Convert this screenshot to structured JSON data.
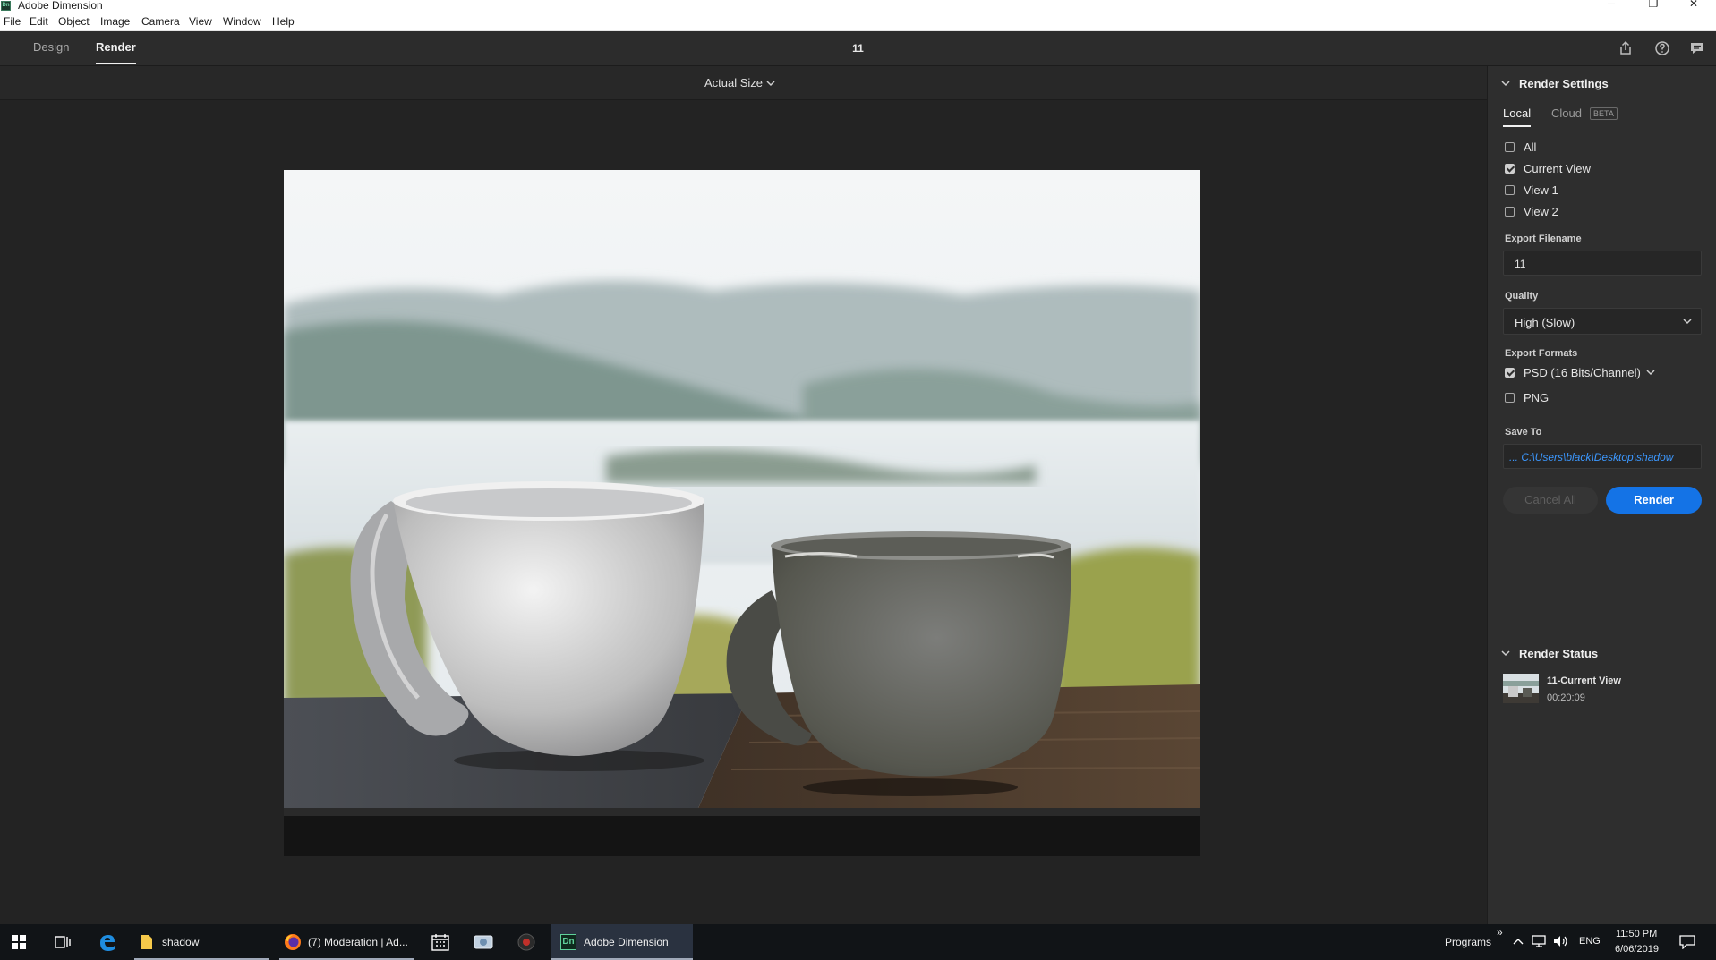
{
  "window": {
    "title": "Adobe Dimension",
    "app_icon_text": "Dn",
    "controls": {
      "minimize": "─",
      "restore": "❐",
      "close": "✕"
    }
  },
  "menu": [
    "File",
    "Edit",
    "Object",
    "Image",
    "Camera",
    "View",
    "Window",
    "Help"
  ],
  "mode_tabs": [
    {
      "label": "Design",
      "active": false
    },
    {
      "label": "Render",
      "active": true
    }
  ],
  "document_name": "11",
  "view": {
    "zoom_label": "Actual Size"
  },
  "render_settings": {
    "title": "Render Settings",
    "tabs": [
      {
        "label": "Local",
        "active": true
      },
      {
        "label": "Cloud",
        "active": false
      }
    ],
    "beta_badge": "BETA",
    "views": [
      {
        "label": "All",
        "checked": false
      },
      {
        "label": "Current View",
        "checked": true
      },
      {
        "label": "View 1",
        "checked": false
      },
      {
        "label": "View 2",
        "checked": false
      }
    ],
    "export_filename_label": "Export Filename",
    "export_filename_value": "11",
    "quality_label": "Quality",
    "quality_value": "High (Slow)",
    "export_formats_label": "Export Formats",
    "formats": [
      {
        "label": "PSD (16 Bits/Channel)",
        "checked": true
      },
      {
        "label": "PNG",
        "checked": false
      }
    ],
    "save_to_label": "Save To",
    "save_to_value": "... C:\\Users\\black\\Desktop\\shadow",
    "cancel_label": "Cancel All",
    "render_label": "Render"
  },
  "render_status": {
    "title": "Render Status",
    "jobs": [
      {
        "name": "11-Current View",
        "time": "00:20:09"
      }
    ]
  },
  "taskbar": {
    "items": [
      {
        "label": "shadow",
        "icon": "folder-icon"
      },
      {
        "label": "(7) Moderation | Ad...",
        "icon": "firefox-icon"
      },
      {
        "label": "Adobe Dimension",
        "icon": "dimension-icon"
      }
    ],
    "programs_label": "Programs",
    "chevron_label": "»",
    "language": "ENG",
    "time": "11:50 PM",
    "date": "6/06/2019",
    "dn_badge": "Dn"
  },
  "colors": {
    "accent": "#1473e6",
    "panel_bg": "#2e2e2e",
    "canvas_bg": "#232323",
    "link": "#3c98ff"
  }
}
